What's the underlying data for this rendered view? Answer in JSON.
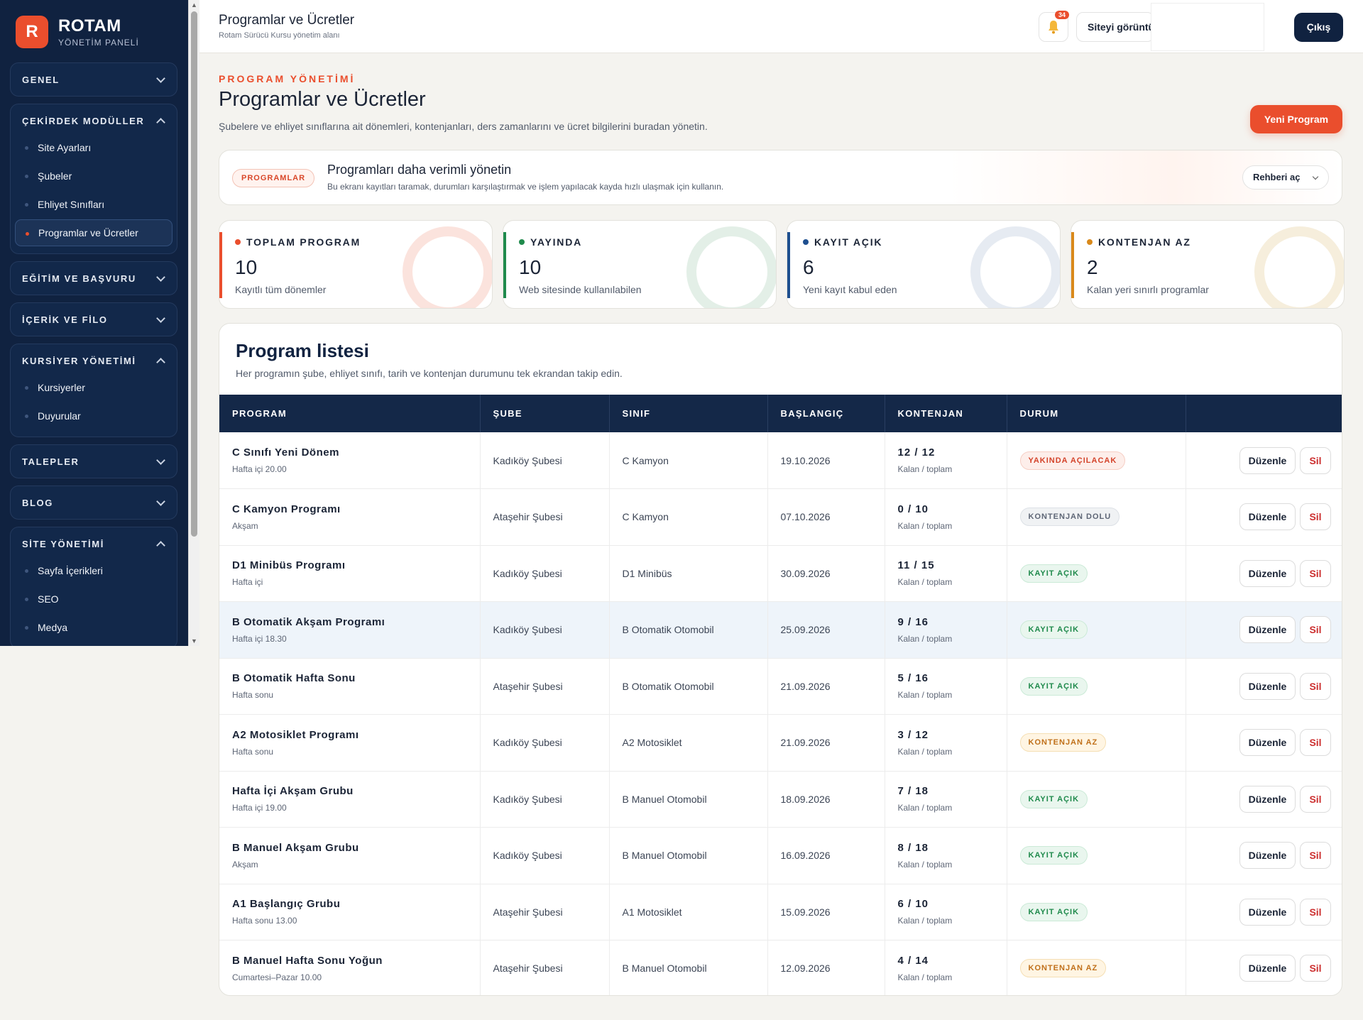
{
  "brand": {
    "logo_letter": "R",
    "name": "ROTAM",
    "subtitle": "YÖNETİM PANELİ"
  },
  "sidebar": {
    "groups": [
      {
        "title": "GENEL",
        "expanded": false,
        "items": []
      },
      {
        "title": "ÇEKİRDEK MODÜLLER",
        "expanded": true,
        "items": [
          {
            "label": "Site Ayarları",
            "active": false
          },
          {
            "label": "Şubeler",
            "active": false
          },
          {
            "label": "Ehliyet Sınıfları",
            "active": false
          },
          {
            "label": "Programlar ve Ücretler",
            "active": true
          }
        ]
      },
      {
        "title": "EĞİTİM VE BAŞVURU",
        "expanded": false,
        "items": []
      },
      {
        "title": "İÇERİK VE FİLO",
        "expanded": false,
        "items": []
      },
      {
        "title": "KURSİYER YÖNETİMİ",
        "expanded": true,
        "items": [
          {
            "label": "Kursiyerler",
            "active": false
          },
          {
            "label": "Duyurular",
            "active": false
          }
        ]
      },
      {
        "title": "TALEPLER",
        "expanded": false,
        "items": []
      },
      {
        "title": "BLOG",
        "expanded": false,
        "items": []
      },
      {
        "title": "SİTE YÖNETİMİ",
        "expanded": true,
        "items": [
          {
            "label": "Sayfa İçerikleri",
            "active": false
          },
          {
            "label": "SEO",
            "active": false
          },
          {
            "label": "Medya",
            "active": false
          }
        ]
      }
    ]
  },
  "header": {
    "title": "Programlar ve Ücretler",
    "subtitle": "Rotam Sürücü Kursu yönetim alanı",
    "notification_count": "34",
    "view_site_label": "Siteyi görüntüle",
    "logout_label": "Çıkış"
  },
  "page": {
    "eyebrow": "PROGRAM YÖNETİMİ",
    "title": "Programlar ve Ücretler",
    "description": "Şubelere ve ehliyet sınıflarına ait dönemleri, kontenjanları, ders zamanlarını ve ücret bilgilerini buradan yönetin.",
    "new_button": "Yeni Program"
  },
  "guide": {
    "pill": "PROGRAMLAR",
    "title": "Programları daha verimli yönetin",
    "description": "Bu ekranı kayıtları taramak, durumları karşılaştırmak ve işlem yapılacak kayda hızlı ulaşmak için kullanın.",
    "button": "Rehberi aç"
  },
  "stats": [
    {
      "label": "TOPLAM PROGRAM",
      "value": "10",
      "hint": "Kayıtlı tüm dönemler",
      "color": "#ea4e2d",
      "ring": "#fbe3dd"
    },
    {
      "label": "YAYINDA",
      "value": "10",
      "hint": "Web sitesinde kullanılabilen",
      "color": "#1f8a4c",
      "ring": "#e3efe7"
    },
    {
      "label": "KAYIT AÇIK",
      "value": "6",
      "hint": "Yeni kayıt kabul eden",
      "color": "#1e4f8f",
      "ring": "#e6ebf2"
    },
    {
      "label": "KONTENJAN AZ",
      "value": "2",
      "hint": "Kalan yeri sınırlı programlar",
      "color": "#d9891b",
      "ring": "#f6eedc"
    }
  ],
  "table": {
    "title": "Program listesi",
    "description": "Her programın şube, ehliyet sınıfı, tarih ve kontenjan durumunu tek ekrandan takip edin.",
    "columns": [
      "PROGRAM",
      "ŞUBE",
      "SINIF",
      "BAŞLANGIÇ",
      "KONTENJAN",
      "DURUM",
      ""
    ],
    "quota_sub": "Kalan / toplam",
    "edit_label": "Düzenle",
    "delete_label": "Sil",
    "rows": [
      {
        "name": "C Sınıfı Yeni Dönem",
        "schedule": "Hafta içi 20.00",
        "branch": "Kadıköy Şubesi",
        "class": "C Kamyon",
        "start": "19.10.2026",
        "quota": "12 / 12",
        "status": "YAKINDA AÇILACAK",
        "status_kind": "soon"
      },
      {
        "name": "C Kamyon Programı",
        "schedule": "Akşam",
        "branch": "Ataşehir Şubesi",
        "class": "C Kamyon",
        "start": "07.10.2026",
        "quota": "0 / 10",
        "status": "KONTENJAN DOLU",
        "status_kind": "full"
      },
      {
        "name": "D1 Minibüs Programı",
        "schedule": "Hafta içi",
        "branch": "Kadıköy Şubesi",
        "class": "D1 Minibüs",
        "start": "30.09.2026",
        "quota": "11 / 15",
        "status": "KAYIT AÇIK",
        "status_kind": "open"
      },
      {
        "name": "B Otomatik Akşam Programı",
        "schedule": "Hafta içi 18.30",
        "branch": "Kadıköy Şubesi",
        "class": "B Otomatik Otomobil",
        "start": "25.09.2026",
        "quota": "9 / 16",
        "status": "KAYIT AÇIK",
        "status_kind": "open",
        "highlight": true
      },
      {
        "name": "B Otomatik Hafta Sonu",
        "schedule": "Hafta sonu",
        "branch": "Ataşehir Şubesi",
        "class": "B Otomatik Otomobil",
        "start": "21.09.2026",
        "quota": "5 / 16",
        "status": "KAYIT AÇIK",
        "status_kind": "open"
      },
      {
        "name": "A2 Motosiklet Programı",
        "schedule": "Hafta sonu",
        "branch": "Kadıköy Şubesi",
        "class": "A2 Motosiklet",
        "start": "21.09.2026",
        "quota": "3 / 12",
        "status": "KONTENJAN AZ",
        "status_kind": "low"
      },
      {
        "name": "Hafta İçi Akşam Grubu",
        "schedule": "Hafta içi 19.00",
        "branch": "Kadıköy Şubesi",
        "class": "B Manuel Otomobil",
        "start": "18.09.2026",
        "quota": "7 / 18",
        "status": "KAYIT AÇIK",
        "status_kind": "open"
      },
      {
        "name": "B Manuel Akşam Grubu",
        "schedule": "Akşam",
        "branch": "Kadıköy Şubesi",
        "class": "B Manuel Otomobil",
        "start": "16.09.2026",
        "quota": "8 / 18",
        "status": "KAYIT AÇIK",
        "status_kind": "open"
      },
      {
        "name": "A1 Başlangıç Grubu",
        "schedule": "Hafta sonu 13.00",
        "branch": "Ataşehir Şubesi",
        "class": "A1 Motosiklet",
        "start": "15.09.2026",
        "quota": "6 / 10",
        "status": "KAYIT AÇIK",
        "status_kind": "open"
      },
      {
        "name": "B Manuel Hafta Sonu Yoğun",
        "schedule": "Cumartesi–Pazar 10.00",
        "branch": "Ataşehir Şubesi",
        "class": "B Manuel Otomobil",
        "start": "12.09.2026",
        "quota": "4 / 14",
        "status": "KONTENJAN AZ",
        "status_kind": "low"
      }
    ]
  }
}
